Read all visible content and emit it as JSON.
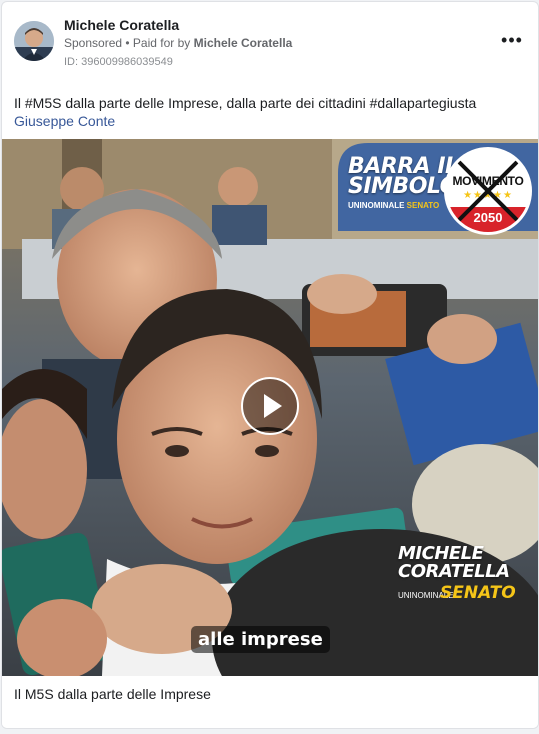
{
  "post": {
    "author": "Michele Coratella",
    "sponsored_label": "Sponsored",
    "paid_for_prefix": " • Paid for by ",
    "paid_for_name": "Michele Coratella",
    "ad_id": "ID: 396009986039549",
    "more_icon": "more-dots-icon",
    "caption_text": "Il #M5S dalla parte delle Imprese, dalla parte dei cittadini #dallapartegiusta",
    "caption_link": "Giuseppe Conte"
  },
  "video": {
    "overlay_title_line1": "BARRA IL",
    "overlay_title_line2": "SIMBOLO",
    "overlay_sub_prefix": "UNINOMINALE ",
    "overlay_sub_senato": "SENATO",
    "logo_text": "MOVIMENTO",
    "logo_stars": "★★★★★",
    "logo_year": "2050",
    "candidate_line1": "MICHELE",
    "candidate_line2": "CORATELLA",
    "candidate_sub": "UNINOMINALE",
    "candidate_senato": "SENATO",
    "subtitle": "alle imprese",
    "play_icon": "play-icon"
  },
  "footer": {
    "title": "Il M5S dalla parte delle Imprese"
  },
  "colors": {
    "link": "#385898",
    "accent_yellow": "#f5c518",
    "logo_red": "#d8232a"
  }
}
